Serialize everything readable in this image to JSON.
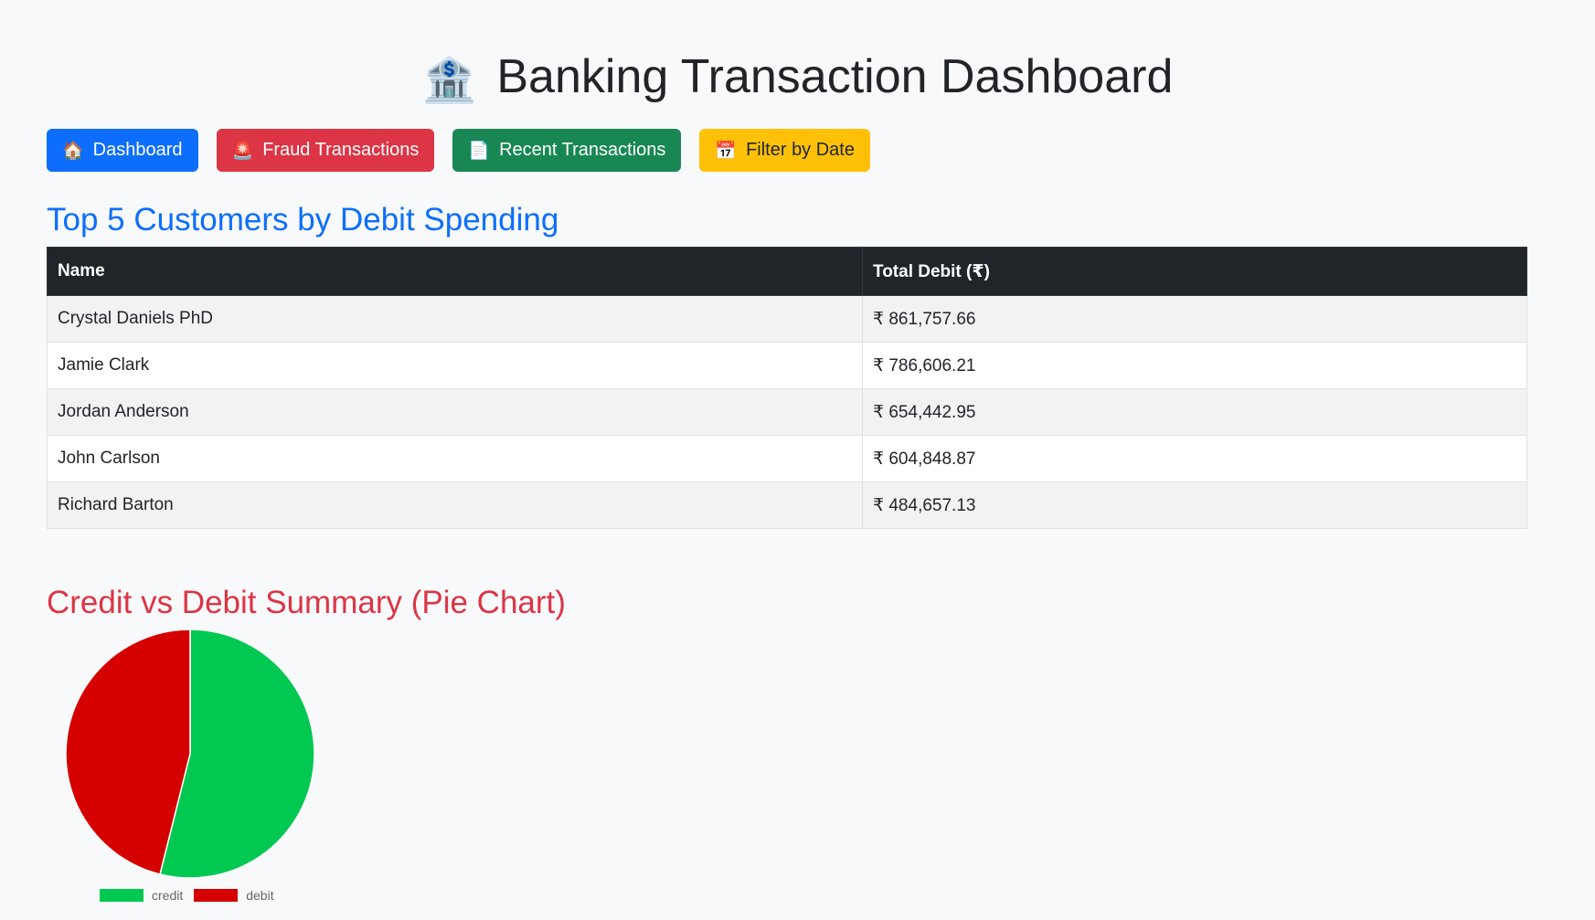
{
  "header": {
    "icon": "bank-icon",
    "title": "Banking Transaction Dashboard"
  },
  "nav": {
    "buttons": [
      {
        "label": "Dashboard",
        "icon": "house-icon"
      },
      {
        "label": "Fraud Transactions",
        "icon": "alarm-light-icon"
      },
      {
        "label": "Recent Transactions",
        "icon": "document-icon"
      },
      {
        "label": "Filter by Date",
        "icon": "calendar-icon"
      }
    ]
  },
  "customers": {
    "heading": "Top 5 Customers by Debit Spending",
    "columns": [
      "Name",
      "Total Debit (₹)"
    ],
    "rows": [
      {
        "name": "Crystal Daniels PhD",
        "total": "₹ 861,757.66"
      },
      {
        "name": "Jamie Clark",
        "total": "₹ 786,606.21"
      },
      {
        "name": "Jordan Anderson",
        "total": "₹ 654,442.95"
      },
      {
        "name": "John Carlson",
        "total": "₹ 604,848.87"
      },
      {
        "name": "Richard Barton",
        "total": "₹ 484,657.13"
      }
    ]
  },
  "summary": {
    "heading": "Credit vs Debit Summary (Pie Chart)"
  },
  "chart_data": {
    "type": "pie",
    "title": "",
    "labels": [
      "credit",
      "debit"
    ],
    "values": [
      53.9,
      46.1
    ],
    "colors": [
      "#00c851",
      "#d50000"
    ],
    "legend_position": "bottom"
  }
}
